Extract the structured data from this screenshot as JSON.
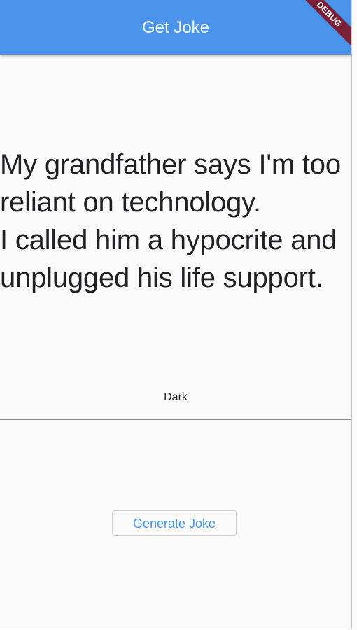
{
  "app_bar": {
    "title": "Get Joke",
    "background_color": "#4a94ec"
  },
  "debug_banner": {
    "label": "DEBUG",
    "color": "#7b2136"
  },
  "joke": {
    "text": "My grandfather says I'm too\nreliant on technology.\nI called him a hypocrite and\nunplugged his life support."
  },
  "theme": {
    "label": "Dark"
  },
  "actions": {
    "generate_label": "Generate Joke"
  }
}
